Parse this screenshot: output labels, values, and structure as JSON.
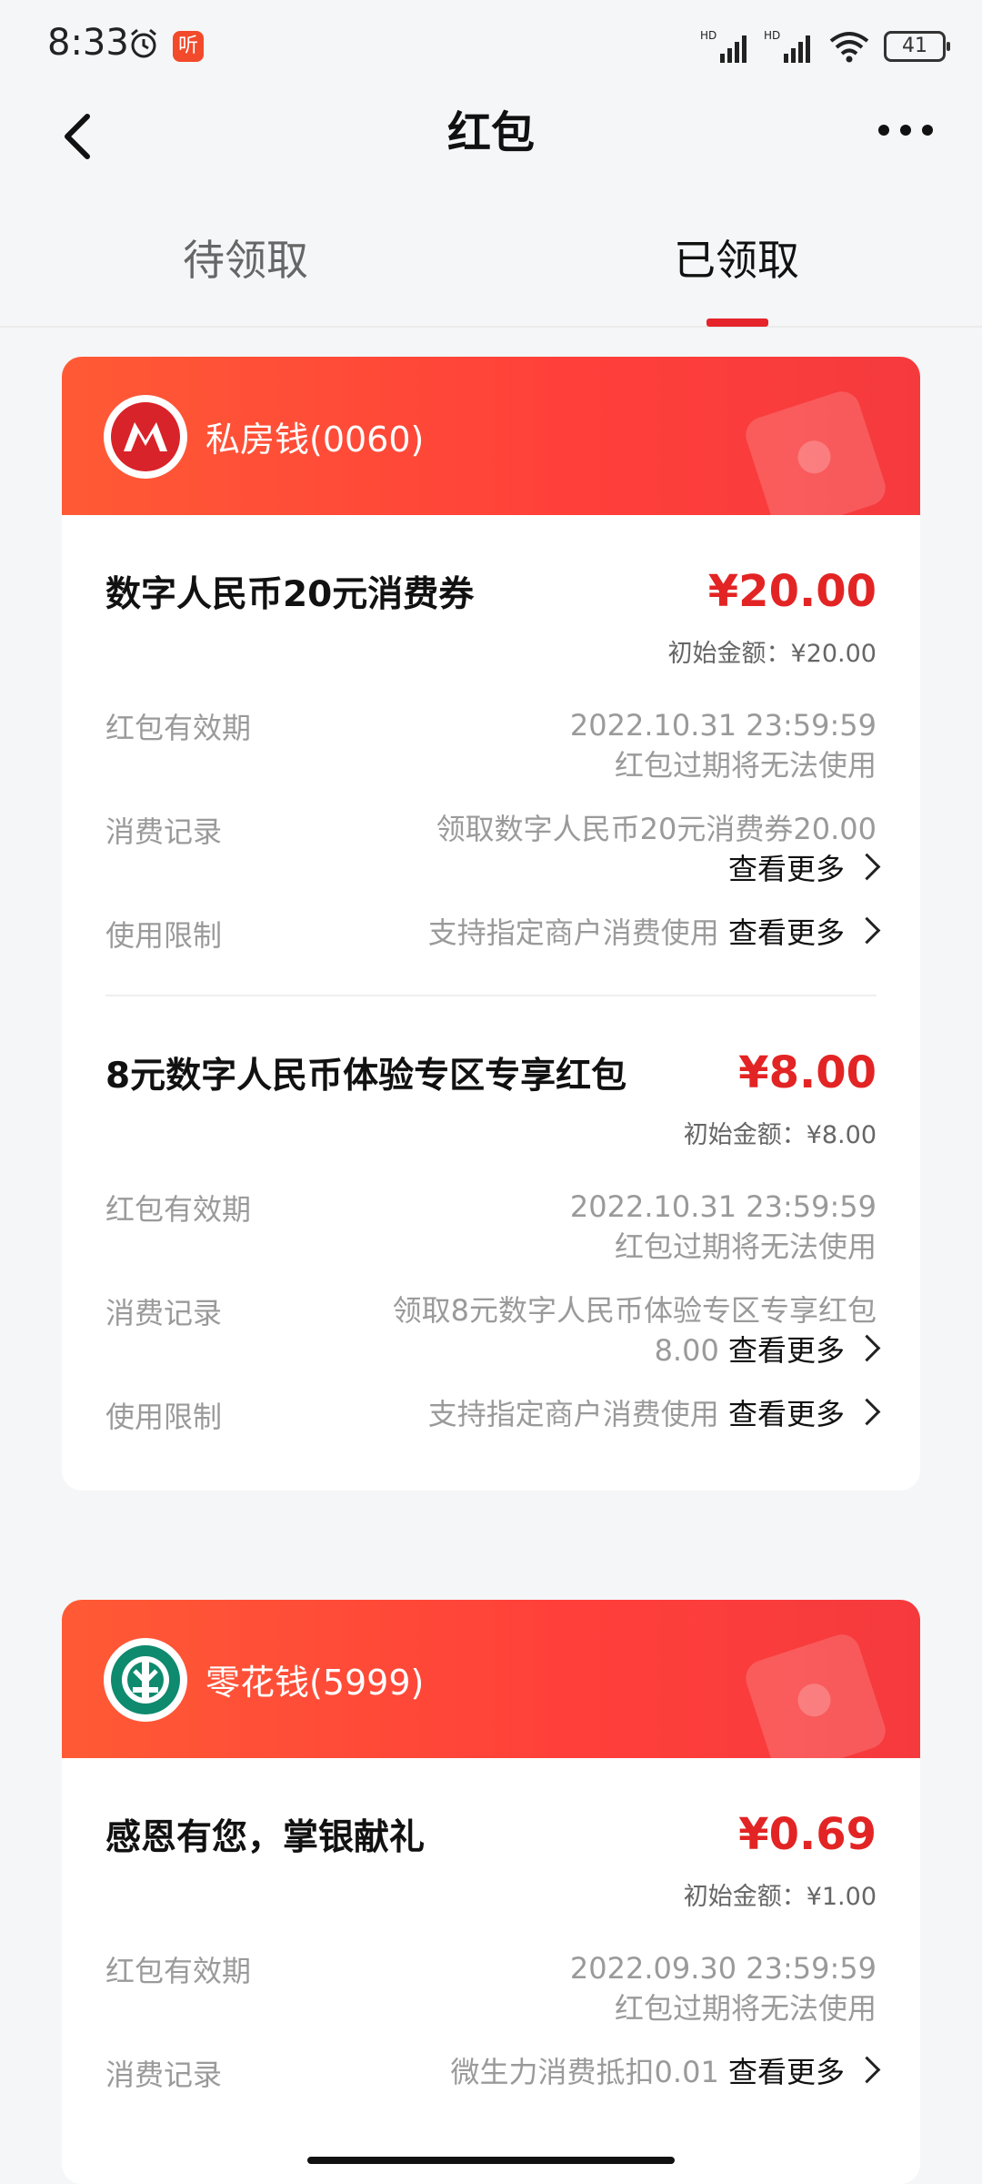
{
  "status": {
    "time": "8:33",
    "app_badge": "听",
    "battery": "41"
  },
  "nav": {
    "title": "红包"
  },
  "tabs": [
    {
      "label": "待领取"
    },
    {
      "label": "已领取"
    }
  ],
  "colors": {
    "accent": "#e32424",
    "header": "#ff4a37"
  },
  "cards": [
    {
      "account": "私房钱(0060)",
      "bank_icon": "cmb-logo-icon",
      "items": [
        {
          "title": "数字人民币20元消费券",
          "amount": "¥20.00",
          "initial": "初始金额：¥20.00",
          "validity_label": "红包有效期",
          "validity_date": "2022.10.31 23:59:59",
          "validity_note": "红包过期将无法使用",
          "record_label": "消费记录",
          "record_text": "领取数字人民币20元消费券20.00",
          "record_more": "查看更多",
          "limit_label": "使用限制",
          "limit_text": "支持指定商户消费使用",
          "limit_more": "查看更多"
        },
        {
          "title": "8元数字人民币体验专区专享红包",
          "amount": "¥8.00",
          "initial": "初始金额：¥8.00",
          "validity_label": "红包有效期",
          "validity_date": "2022.10.31 23:59:59",
          "validity_note": "红包过期将无法使用",
          "record_label": "消费记录",
          "record_text_1": "领取8元数字人民币体验专区专享红包",
          "record_text_2": "8.00",
          "record_more": "查看更多",
          "limit_label": "使用限制",
          "limit_text": "支持指定商户消费使用",
          "limit_more": "查看更多"
        }
      ]
    },
    {
      "account": "零花钱(5999)",
      "bank_icon": "abc-logo-icon",
      "items": [
        {
          "title": "感恩有您，掌银献礼",
          "amount": "¥0.69",
          "initial": "初始金额：¥1.00",
          "validity_label": "红包有效期",
          "validity_date": "2022.09.30 23:59:59",
          "validity_note": "红包过期将无法使用",
          "record_label": "消费记录",
          "record_text": "微生力消费抵扣0.01",
          "record_more": "查看更多"
        }
      ]
    }
  ]
}
